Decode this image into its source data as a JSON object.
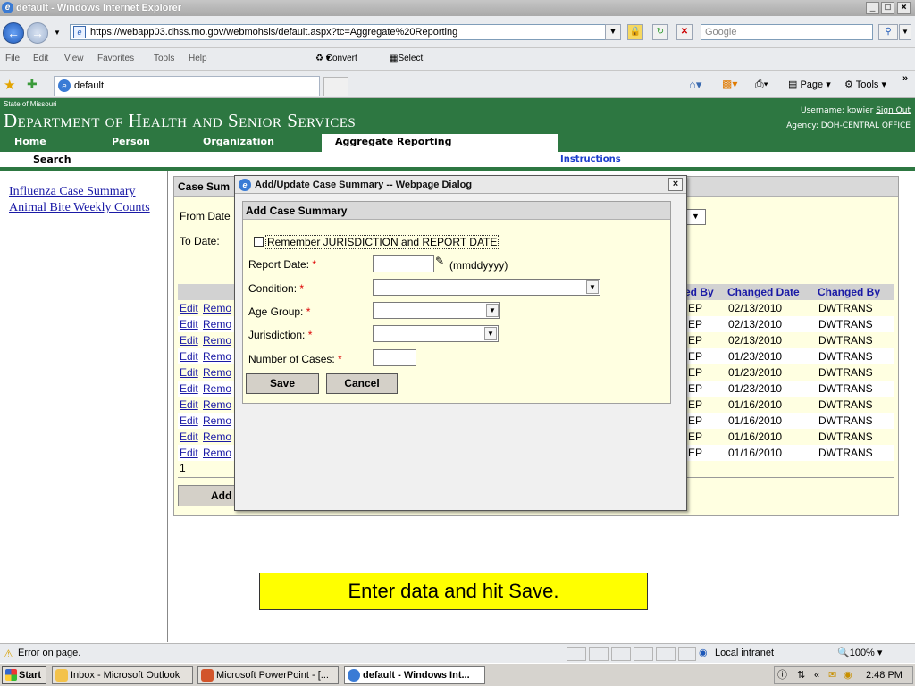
{
  "window": {
    "title": "default - Windows Internet Explorer",
    "controls": [
      "_",
      "□",
      "×"
    ]
  },
  "address": {
    "url": "https://webapp03.dhss.mo.gov/webmohsis/default.aspx?tc=Aggregate%20Reporting",
    "search_placeholder": "Google"
  },
  "menu": {
    "items": [
      "File",
      "Edit",
      "View",
      "Favorites",
      "Tools",
      "Help"
    ],
    "convert": "Convert",
    "select": "Select"
  },
  "tab": {
    "title": "default",
    "page_label": "Page",
    "tools_label": "Tools"
  },
  "site": {
    "state": "State of Missouri",
    "department": "Department of Health and Senior Services",
    "username_label": "Username:",
    "username": "kowier",
    "signout": "Sign Out",
    "agency_label": "Agency:",
    "agency": "DOH-CENTRAL OFFICE",
    "nav": [
      "Home",
      "Person",
      "Organization"
    ],
    "active_nav": "Aggregate Reporting",
    "subnav_search": "Search",
    "instructions": "Instructions"
  },
  "left_links": [
    "Influenza Case Summary",
    "Animal Bite Weekly Counts"
  ],
  "main": {
    "header": "Case Sum",
    "from_label": "From Date",
    "to_label": "To Date:",
    "columns": [
      "ed By",
      "Changed Date",
      "Changed By"
    ],
    "rows": [
      {
        "edit": "Edit",
        "remove": "Remo",
        "by": "EP",
        "date": "02/13/2010",
        "changed_by": "DWTRANS"
      },
      {
        "edit": "Edit",
        "remove": "Remo",
        "by": "EP",
        "date": "02/13/2010",
        "changed_by": "DWTRANS"
      },
      {
        "edit": "Edit",
        "remove": "Remo",
        "by": "EP",
        "date": "02/13/2010",
        "changed_by": "DWTRANS"
      },
      {
        "edit": "Edit",
        "remove": "Remo",
        "by": "EP",
        "date": "01/23/2010",
        "changed_by": "DWTRANS"
      },
      {
        "edit": "Edit",
        "remove": "Remo",
        "by": "EP",
        "date": "01/23/2010",
        "changed_by": "DWTRANS"
      },
      {
        "edit": "Edit",
        "remove": "Remo",
        "by": "EP",
        "date": "01/23/2010",
        "changed_by": "DWTRANS"
      },
      {
        "edit": "Edit",
        "remove": "Remo",
        "by": "EP",
        "date": "01/16/2010",
        "changed_by": "DWTRANS"
      },
      {
        "edit": "Edit",
        "remove": "Remo",
        "by": "EP",
        "date": "01/16/2010",
        "changed_by": "DWTRANS"
      },
      {
        "edit": "Edit",
        "remove": "Remo",
        "by": "EP",
        "date": "01/16/2010",
        "changed_by": "DWTRANS"
      },
      {
        "edit": "Edit",
        "remove": "Remo",
        "by": "EP",
        "date": "01/16/2010",
        "changed_by": "DWTRANS"
      }
    ],
    "page_number": "1",
    "add_button": "Add"
  },
  "dialog": {
    "title": "Add/Update Case Summary -- Webpage Dialog",
    "close": "×",
    "header": "Add Case Summary",
    "remember_label": "Remember JURISDICTION and REPORT DATE",
    "report_date_label": "Report Date:",
    "date_hint": "(mmddyyyy)",
    "condition_label": "Condition:",
    "age_group_label": "Age Group:",
    "jurisdiction_label": "Jurisdiction:",
    "cases_label": "Number of Cases:",
    "required_mark": "*",
    "save": "Save",
    "cancel": "Cancel",
    "report_date_value": "",
    "cases_value": ""
  },
  "callout": "Enter data and hit Save.",
  "status": {
    "message": "Error on page.",
    "zone": "Local intranet",
    "zoom": "100%"
  },
  "taskbar": {
    "start": "Start",
    "tasks": [
      "Inbox - Microsoft Outlook",
      "Microsoft PowerPoint - [...",
      "default - Windows Int..."
    ],
    "clock": "2:48 PM"
  },
  "icons": {
    "back": "back-arrow-icon",
    "forward": "forward-arrow-icon",
    "lock": "lock-icon",
    "refresh": "refresh-icon",
    "stop": "stop-icon",
    "search": "search-icon",
    "calendar": "calendar-icon",
    "warning": "warning-icon"
  },
  "colors": {
    "header_green": "#2d7741",
    "panel_yellow": "#ffffe1",
    "link_blue": "#1a1aa6",
    "callout_yellow": "#ffff00",
    "required_red": "#dd0000"
  },
  "chart_data": {
    "type": "table",
    "columns": [
      "ed By",
      "Changed Date",
      "Changed By"
    ],
    "rows": [
      [
        "EP",
        "02/13/2010",
        "DWTRANS"
      ],
      [
        "EP",
        "02/13/2010",
        "DWTRANS"
      ],
      [
        "EP",
        "02/13/2010",
        "DWTRANS"
      ],
      [
        "EP",
        "01/23/2010",
        "DWTRANS"
      ],
      [
        "EP",
        "01/23/2010",
        "DWTRANS"
      ],
      [
        "EP",
        "01/23/2010",
        "DWTRANS"
      ],
      [
        "EP",
        "01/16/2010",
        "DWTRANS"
      ],
      [
        "EP",
        "01/16/2010",
        "DWTRANS"
      ],
      [
        "EP",
        "01/16/2010",
        "DWTRANS"
      ],
      [
        "EP",
        "01/16/2010",
        "DWTRANS"
      ]
    ]
  }
}
